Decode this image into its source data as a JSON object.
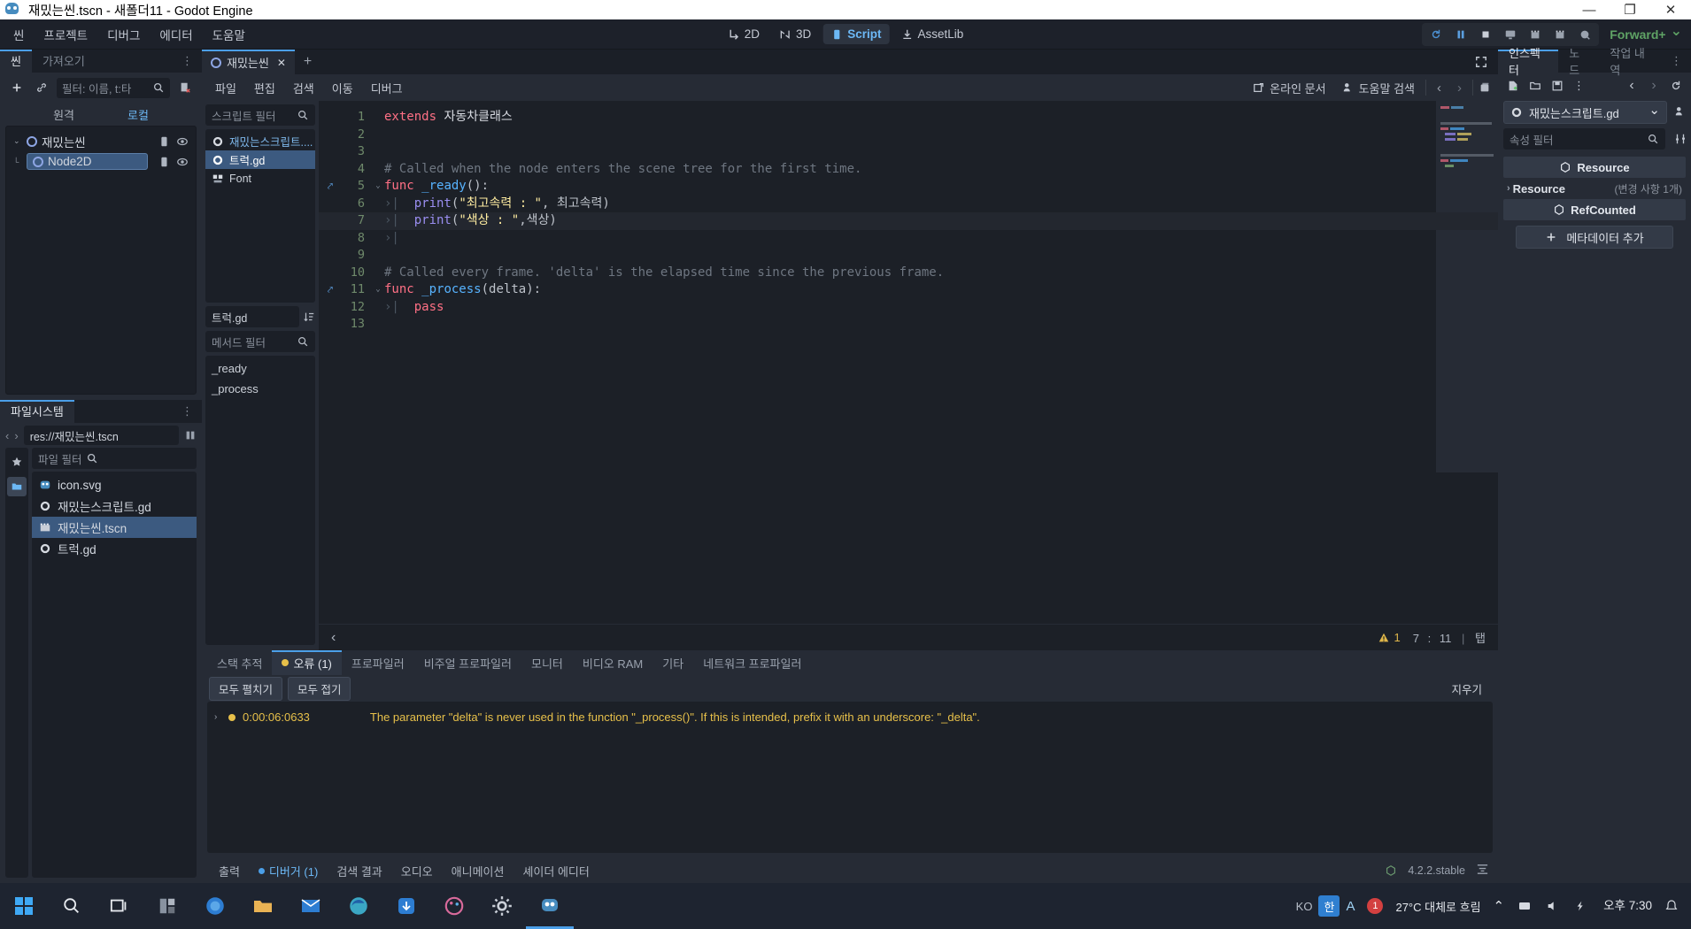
{
  "window": {
    "title": "재밌는씬.tscn - 새폴더11 - Godot Engine",
    "minimize": "—",
    "maximize": "❐",
    "close": "✕"
  },
  "menubar": {
    "items": [
      "씬",
      "프로젝트",
      "디버그",
      "에디터",
      "도움말"
    ],
    "modes": [
      {
        "label": "2D",
        "icon": "2d-icon",
        "active": false
      },
      {
        "label": "3D",
        "icon": "3d-icon",
        "active": false
      },
      {
        "label": "Script",
        "icon": "script-icon",
        "active": true
      },
      {
        "label": "AssetLib",
        "icon": "assetlib-icon",
        "active": false
      }
    ],
    "tools": [
      "reload-icon",
      "pause-icon",
      "stop-icon",
      "play-scene-icon",
      "movie-start-icon",
      "movie-stop-icon",
      "remote-debug-icon"
    ],
    "renderer": "Forward+",
    "renderer_chevron": "⌄"
  },
  "scene_panel": {
    "tabs": [
      {
        "label": "씬",
        "active": true
      },
      {
        "label": "가져오기",
        "active": false
      }
    ],
    "menu_dots": "⋮",
    "filter_placeholder": "필터: 이름, t:타",
    "add_icon": "plus-icon",
    "link_icon": "link-icon",
    "search_icon": "search-icon",
    "instance_icon": "remove-script-icon",
    "modes": [
      {
        "label": "원격",
        "active": false
      },
      {
        "label": "로컬",
        "active": true
      }
    ],
    "nodes": [
      {
        "label": "재밌는씬",
        "depth": 0,
        "selected": false,
        "expander": "⌄"
      },
      {
        "label": "Node2D",
        "depth": 1,
        "selected": true,
        "expander": ""
      }
    ]
  },
  "filesystem": {
    "tab": "파일시스템",
    "menu_dots": "⋮",
    "back_arrow": "‹",
    "forward_arrow": "›",
    "path": "res://재밌는씬.tscn",
    "split_icon": "split-icon",
    "filter_placeholder": "파일 필터",
    "search_icon": "search-icon",
    "sort_icon": "sort-icon",
    "grid_icon": "grid-icon",
    "favorite_icon": "star-icon",
    "folder_icon": "folder-icon",
    "files": [
      {
        "name": "icon.svg",
        "icon": "godot-icon",
        "selected": false
      },
      {
        "name": "재밌는스크립트.gd",
        "icon": "gdscript-icon",
        "selected": false
      },
      {
        "name": "재밌는씬.tscn",
        "icon": "scene-icon",
        "selected": true
      },
      {
        "name": "트럭.gd",
        "icon": "gdscript-icon",
        "selected": false
      }
    ]
  },
  "script_editor": {
    "tab": {
      "label": "재밌는씬",
      "close": "✕"
    },
    "add_tab": "+",
    "fullscreen_icon": "distraction-free-icon",
    "menu": [
      "파일",
      "편집",
      "검색",
      "이동",
      "디버그"
    ],
    "online_docs": "온라인 문서",
    "help_search": "도움말 검색",
    "prev_arrow": "‹",
    "next_arrow": "›",
    "history_icon": "history-icon",
    "script_filter_placeholder": "스크립트 필터",
    "scripts": [
      {
        "name": "재밌는스크립트....",
        "icon": "gdscript-icon",
        "selected": false,
        "modified": false
      },
      {
        "name": "트럭.gd",
        "icon": "gdscript-icon",
        "selected": true,
        "modified": false
      },
      {
        "name": "Font",
        "icon": "doc-icon",
        "selected": false,
        "modified": false
      }
    ],
    "current_script": "트럭.gd",
    "sort_icon": "sort-icon",
    "method_filter_placeholder": "메서드 필터",
    "methods": [
      "_ready",
      "_process"
    ]
  },
  "code": {
    "lines": [
      {
        "n": 1,
        "connection": false,
        "fold": "",
        "tabs": 0,
        "tokens": [
          {
            "t": "extends ",
            "c": "key"
          },
          {
            "t": "자동차클래스",
            "c": "cls"
          }
        ]
      },
      {
        "n": 2,
        "connection": false,
        "fold": "",
        "tabs": 0,
        "tokens": []
      },
      {
        "n": 3,
        "connection": false,
        "fold": "",
        "tabs": 0,
        "tokens": []
      },
      {
        "n": 4,
        "connection": false,
        "fold": "",
        "tabs": 0,
        "tokens": [
          {
            "t": "# Called when the node enters the scene tree for the first time.",
            "c": "com"
          }
        ]
      },
      {
        "n": 5,
        "connection": true,
        "fold": "⌄",
        "tabs": 0,
        "tokens": [
          {
            "t": "func ",
            "c": "key"
          },
          {
            "t": "_ready",
            "c": "fn"
          },
          {
            "t": "():",
            "c": "pun"
          }
        ]
      },
      {
        "n": 6,
        "connection": false,
        "fold": "",
        "tabs": 1,
        "tokens": [
          {
            "t": "print",
            "c": "mem"
          },
          {
            "t": "(",
            "c": "pun"
          },
          {
            "t": "\"최고속력 : \"",
            "c": "str"
          },
          {
            "t": ", ",
            "c": "pun"
          },
          {
            "t": "최고속력",
            "c": "var"
          },
          {
            "t": ")",
            "c": "pun"
          }
        ]
      },
      {
        "n": 7,
        "connection": false,
        "fold": "",
        "tabs": 1,
        "highlight": true,
        "tokens": [
          {
            "t": "print",
            "c": "mem"
          },
          {
            "t": "(",
            "c": "pun"
          },
          {
            "t": "\"색상 : \"",
            "c": "str"
          },
          {
            "t": ",",
            "c": "pun"
          },
          {
            "t": "색상",
            "c": "var"
          },
          {
            "t": ")",
            "c": "pun"
          }
        ]
      },
      {
        "n": 8,
        "connection": false,
        "fold": "",
        "tabs": 1,
        "tokens": []
      },
      {
        "n": 9,
        "connection": false,
        "fold": "",
        "tabs": 0,
        "tokens": []
      },
      {
        "n": 10,
        "connection": false,
        "fold": "",
        "tabs": 0,
        "tokens": [
          {
            "t": "# Called every frame. 'delta' is the elapsed time since the previous frame.",
            "c": "com"
          }
        ]
      },
      {
        "n": 11,
        "connection": true,
        "fold": "⌄",
        "tabs": 0,
        "tokens": [
          {
            "t": "func ",
            "c": "key"
          },
          {
            "t": "_process",
            "c": "fn"
          },
          {
            "t": "(",
            "c": "pun"
          },
          {
            "t": "delta",
            "c": "var"
          },
          {
            "t": "):",
            "c": "pun"
          }
        ]
      },
      {
        "n": 12,
        "connection": false,
        "fold": "",
        "tabs": 1,
        "tokens": [
          {
            "t": "pass",
            "c": "key"
          }
        ]
      },
      {
        "n": 13,
        "connection": false,
        "fold": "",
        "tabs": 0,
        "tokens": []
      }
    ],
    "status": {
      "collapse_arrow": "‹",
      "warning_icon": "warning-icon",
      "warning_count": "1",
      "line": "7",
      "separator": ":",
      "column": "11",
      "pipe": "|",
      "indent": "탭"
    }
  },
  "debugger": {
    "tabs": [
      {
        "label": "스택 추적",
        "active": false,
        "dot": false
      },
      {
        "label": "오류 (1)",
        "active": true,
        "dot": true
      },
      {
        "label": "프로파일러",
        "active": false,
        "dot": false
      },
      {
        "label": "비주얼 프로파일러",
        "active": false,
        "dot": false
      },
      {
        "label": "모니터",
        "active": false,
        "dot": false
      },
      {
        "label": "비디오 RAM",
        "active": false,
        "dot": false
      },
      {
        "label": "기타",
        "active": false,
        "dot": false
      },
      {
        "label": "네트워크 프로파일러",
        "active": false,
        "dot": false
      }
    ],
    "expand_all": "모두 펼치기",
    "collapse_all": "모두 접기",
    "clear": "지우기",
    "errors": [
      {
        "expander": "›",
        "time": "0:00:06:0633",
        "message": "The parameter \"delta\" is never used in the function \"_process()\". If this is intended, prefix it with an underscore: \"_delta\"."
      }
    ]
  },
  "bottom_dock": {
    "items": [
      {
        "label": "출력",
        "active": false,
        "dot": false
      },
      {
        "label": "디버거 (1)",
        "active": true,
        "dot": true
      },
      {
        "label": "검색 결과",
        "active": false,
        "dot": false
      },
      {
        "label": "오디오",
        "active": false,
        "dot": false
      },
      {
        "label": "애니메이션",
        "active": false,
        "dot": false
      },
      {
        "label": "셰이더 에디터",
        "active": false,
        "dot": false
      }
    ],
    "version": "4.2.2.stable",
    "fps_icon": "mesh-icon",
    "expand_icon": "expand-bottom-icon"
  },
  "inspector": {
    "tabs": [
      {
        "label": "인스펙터",
        "active": true
      },
      {
        "label": "노드",
        "active": false
      },
      {
        "label": "작업 내역",
        "active": false
      }
    ],
    "menu_dots": "⋮",
    "toolbar": [
      "new-resource-icon",
      "load-icon",
      "save-icon",
      "tools-menu-icon"
    ],
    "nav_prev": "‹",
    "nav_next": "›",
    "history_icon": "history-icon",
    "open_docs_icon": "doc-icon",
    "object_name": "재밌는스크립트.gd",
    "object_icon": "gdscript-icon",
    "object_chevron": "⌄",
    "filter_placeholder": "속성 필터",
    "search_icon": "search-icon",
    "settings_icon": "sliders-icon",
    "sections": [
      {
        "type": "header",
        "label": "Resource",
        "icon": "resource-icon"
      },
      {
        "type": "sub",
        "label": "Resource",
        "expander": "›",
        "count": "(변경 사항 1개)"
      },
      {
        "type": "header",
        "label": "RefCounted",
        "icon": "resource-icon"
      }
    ],
    "add_metadata": "메타데이터 추가",
    "add_metadata_icon": "plus-icon"
  },
  "taskbar": {
    "items": [
      "windows-start-icon",
      "search-icon",
      "taskview-icon",
      "widgets-icon",
      "firefox-icon",
      "explorer-icon",
      "mail-icon",
      "edge-icon",
      "download-icon",
      "paint-icon",
      "settings-icon",
      "godot-icon"
    ],
    "ime_lang": "KO",
    "ime_mode": "한",
    "ime_letter": "A",
    "notification_count": "1",
    "weather": "27°C 대체로 흐림",
    "time": "오후 7:30",
    "chevron": "⌃",
    "network_icon": "network-icon",
    "volume_icon": "volume-icon",
    "battery_icon": "battery-icon",
    "notify_icon": "notification-icon"
  },
  "colors": {
    "accent": "#4b9fe8",
    "selection": "#3c5a80",
    "warning": "#e7c04a",
    "keyword": "#ff7085",
    "function": "#57b3ff",
    "string": "#ffeda1",
    "comment": "#6e7681",
    "renderer": "#5fa365"
  }
}
